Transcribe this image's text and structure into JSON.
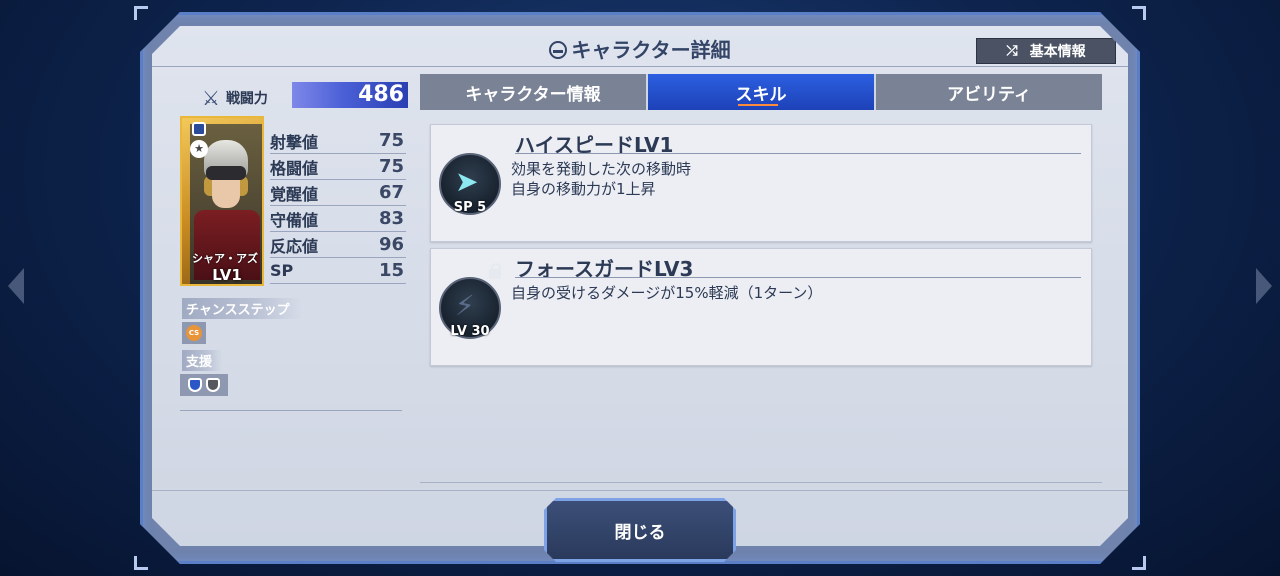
{
  "window": {
    "title": "キャラクター詳細",
    "basic_info_button": "基本情報"
  },
  "power": {
    "label": "戦闘力",
    "value": "486"
  },
  "character": {
    "name": "シャア・アズ",
    "level": "LV1"
  },
  "stats": [
    {
      "label": "射撃値",
      "value": "75"
    },
    {
      "label": "格闘値",
      "value": "75"
    },
    {
      "label": "覚醒値",
      "value": "67"
    },
    {
      "label": "守備値",
      "value": "83"
    },
    {
      "label": "反応値",
      "value": "96"
    },
    {
      "label": "SP",
      "value": "15"
    }
  ],
  "chance_step": {
    "label": "チャンスステップ",
    "badge": "CS"
  },
  "support": {
    "label": "支援"
  },
  "tabs": [
    {
      "label": "キャラクター情報",
      "active": false
    },
    {
      "label": "スキル",
      "active": true
    },
    {
      "label": "アビリティ",
      "active": false
    }
  ],
  "skills": [
    {
      "name": "ハイスピードLV1",
      "lines": [
        "効果を発動した次の移動時",
        "自身の移動力が1上昇"
      ],
      "tag": "SP 5",
      "locked": false
    },
    {
      "name": "フォースガードLV3",
      "lines": [
        "自身の受けるダメージが15%軽減（1ターン）"
      ],
      "tag": "LV 30",
      "locked": true
    }
  ],
  "close_button": "閉じる",
  "colors": {
    "accent": "#1d42b8",
    "power_bar": "#4a5fd6",
    "frame": "#5b7fc7"
  }
}
